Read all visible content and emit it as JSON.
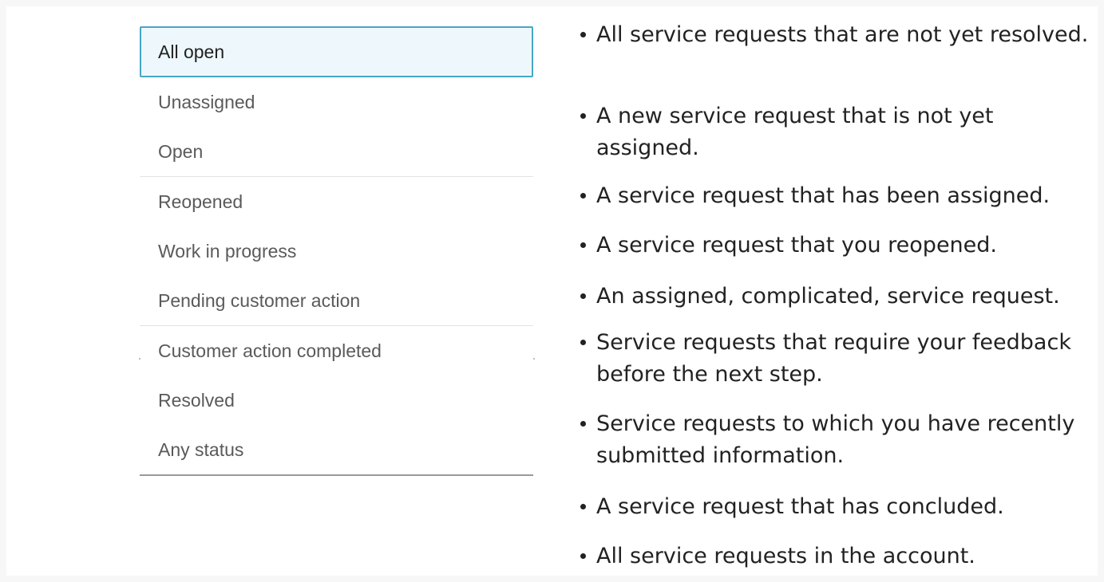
{
  "status_options": [
    {
      "label": "All open"
    },
    {
      "label": "Unassigned"
    },
    {
      "label": "Open"
    },
    {
      "label": "Reopened"
    },
    {
      "label": "Work in progress"
    },
    {
      "label": "Pending customer action"
    },
    {
      "label": "Customer action completed"
    },
    {
      "label": "Resolved"
    },
    {
      "label": "Any status"
    }
  ],
  "descriptions": [
    {
      "text": "All service requests that are not yet resolved."
    },
    {
      "text": "A new service request that is not yet assigned."
    },
    {
      "text": "A service request that has been assigned."
    },
    {
      "text": "A service request that you reopened."
    },
    {
      "text": "An assigned, complicated, service request."
    },
    {
      "text": "Service requests that require your feedback before the next step."
    },
    {
      "text": "Service requests to which you have recently submitted information."
    },
    {
      "text": "A service request that has concluded."
    },
    {
      "text": "All service requests in the account."
    }
  ],
  "colors": {
    "page_background": "#f7f7f7",
    "selected_border": "#46a6c7",
    "selected_fill": "#eef8fc",
    "option_text": "#5a5a5a",
    "description_text": "#222222"
  }
}
